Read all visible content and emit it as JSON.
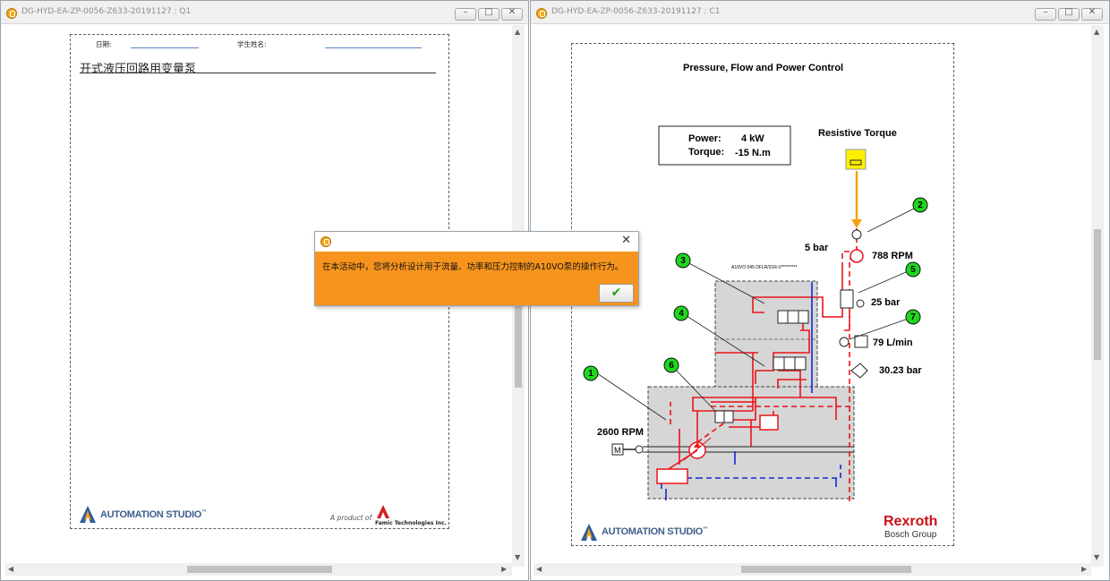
{
  "left_window": {
    "title": "DG-HYD-EA-ZP-0056-Z633-20191127 : Q1",
    "form": {
      "date_label": "日期:",
      "student_label": "学生姓名:",
      "heading": "开式液压回路用变量泵"
    },
    "footer": {
      "logo_text": "AUTOMATION STUDIO",
      "tm": "™",
      "product_of": "A product of",
      "company": "Famic Technologies Inc."
    }
  },
  "right_window": {
    "title": "DG-HYD-EA-ZP-0056-Z633-20191127 : C1",
    "diagram": {
      "title": "Pressure, Flow and Power Control",
      "power_label": "Power:",
      "power_value": "4 kW",
      "torque_label": "Torque:",
      "torque_value": "-15 N.m",
      "resistive_torque": "Resistive Torque",
      "pressure_top": "5 bar",
      "rpm_out": "788 RPM",
      "pressure_mid": "25 bar",
      "flow": "79 L/min",
      "pressure_bottom": "30.23 bar",
      "rpm_in": "2600 RPM",
      "pump_model": "A10VO 045 DFLR/31R-V*********",
      "callouts": [
        "1",
        "2",
        "3",
        "4",
        "5",
        "6",
        "7"
      ]
    },
    "footer": {
      "logo_text": "AUTOMATION STUDIO",
      "tm": "™",
      "brand": "Rexroth",
      "group": "Bosch Group"
    }
  },
  "dialog": {
    "message": "在本活动中，您将分析设计用于流量、功率和压力控制的A10VO泵的操作行为。",
    "close_glyph": "✕",
    "ok_glyph": "✔"
  },
  "colors": {
    "accent": "#f7941d",
    "hydraulic_red": "#e8141b",
    "hydraulic_blue": "#1528d6",
    "callout_green": "#1fd61f",
    "rexroth_red": "#cc1016"
  }
}
